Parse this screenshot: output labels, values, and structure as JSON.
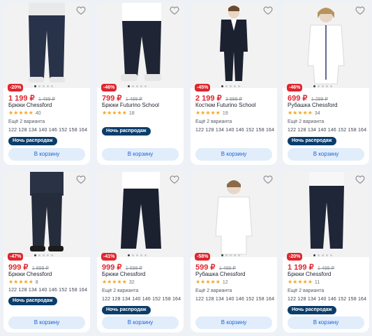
{
  "colors": {
    "accent": "#1a64d6",
    "discount": "#e0262e",
    "badge": "#0b3d6b",
    "star": "#f5a623"
  },
  "cart_label": "В корзину",
  "sale_badge_label": "Ночь распродаж",
  "products": [
    {
      "discount": "-20%",
      "price": "1 199 ₽",
      "old_price": "1 499 ₽",
      "name": "Брюки Chessford",
      "rating_count": "40",
      "variants": "Ещё 2 варианта",
      "sizes": "122 128 134 140 146 152 158 164",
      "colors": {
        "top": "#2a3550",
        "bottom": "#1e2639",
        "skin": "#e8d6c6"
      }
    },
    {
      "discount": "-46%",
      "price": "799 ₽",
      "old_price": "1 499 ₽",
      "name": "Брюки Futurino School",
      "rating_count": "18",
      "variants": "",
      "sizes": "",
      "colors": {
        "top": "#ffffff",
        "bottom": "#1f2535",
        "skin": "#e8d6c6"
      }
    },
    {
      "discount": "-45%",
      "price": "2 199 ₽",
      "old_price": "3 999 ₽",
      "name": "Костюм Futurino School",
      "rating_count": "19",
      "variants": "Ещё 2 варианта",
      "sizes": "122 128 134 140 146 152 158 164",
      "colors": {
        "top": "#1c2130",
        "bottom": "#1c2130",
        "skin": "#e8d6c6"
      }
    },
    {
      "discount": "-46%",
      "price": "699 ₽",
      "old_price": "1 299 ₽",
      "name": "Рубашка Chessford",
      "rating_count": "34",
      "variants": "Ещё 2 варианта",
      "sizes": "122 128 134 140 146 152 158 164",
      "colors": {
        "top": "#ffffff",
        "bottom": "#2b3040",
        "skin": "#e8d6c6"
      }
    },
    {
      "discount": "-47%",
      "price": "999 ₽",
      "old_price": "1 899 ₽",
      "name": "Брюки Chessford",
      "rating_count": "8",
      "variants": "",
      "sizes": "122 128 134 140 146 152 158 164",
      "colors": {
        "top": "#2a3345",
        "bottom": "#252c3b",
        "skin": "#e8d6c6"
      }
    },
    {
      "discount": "-41%",
      "price": "999 ₽",
      "old_price": "1 699 ₽",
      "name": "Брюки Chessford",
      "rating_count": "32",
      "variants": "Ещё 2 варианта",
      "sizes": "122 128 134 140 146 152 158 164",
      "colors": {
        "top": "#ffffff",
        "bottom": "#1c2130",
        "skin": "#e8d6c6"
      }
    },
    {
      "discount": "-58%",
      "price": "599 ₽",
      "old_price": "1 499 ₽",
      "name": "Рубашка Chessford",
      "rating_count": "12",
      "variants": "Ещё 2 варианта",
      "sizes": "122 128 134 140 146 152 158 164",
      "colors": {
        "top": "#ffffff",
        "bottom": "#2b3040",
        "skin": "#e8d6c6"
      }
    },
    {
      "discount": "-20%",
      "price": "1 199 ₽",
      "old_price": "1 499 ₽",
      "name": "Брюки Chessford",
      "rating_count": "11",
      "variants": "Ещё 2 варианта",
      "sizes": "122 128 134 140 146 152 158 164",
      "colors": {
        "top": "#f2f2f2",
        "bottom": "#1f2638",
        "skin": "#e8d6c6"
      }
    }
  ]
}
